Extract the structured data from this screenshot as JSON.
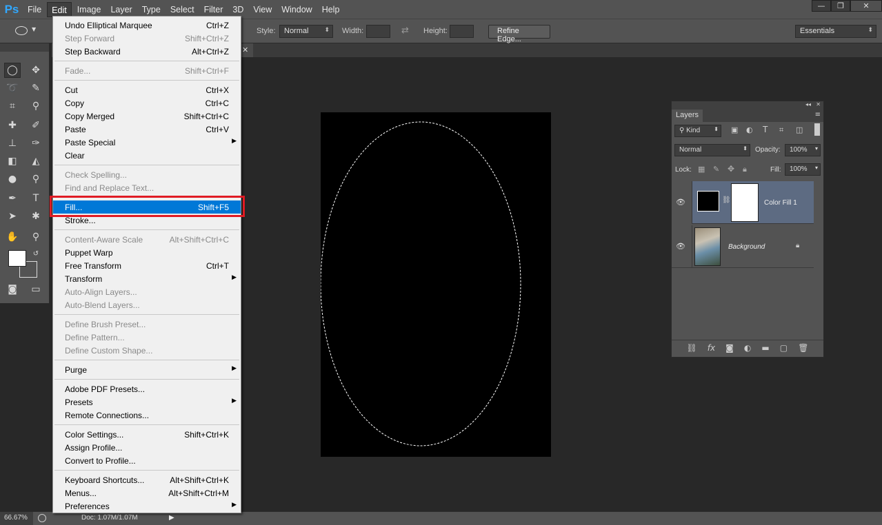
{
  "app": {
    "logo": "Ps"
  },
  "menubar": {
    "items": [
      "File",
      "Edit",
      "Image",
      "Layer",
      "Type",
      "Select",
      "Filter",
      "3D",
      "View",
      "Window",
      "Help"
    ],
    "active": "Edit"
  },
  "window_controls": {
    "minimize": "—",
    "restore": "❐",
    "close": "✕"
  },
  "options_bar": {
    "style_label": "Style:",
    "style_value": "Normal",
    "width_label": "Width:",
    "height_label": "Height:",
    "refine_edge": "Refine Edge...",
    "workspace": "Essentials"
  },
  "status_bar": {
    "zoom": "66.67%",
    "doc": "Doc: 1.07M/1.07M"
  },
  "edit_menu": [
    {
      "label": "Undo Elliptical Marquee",
      "shortcut": "Ctrl+Z",
      "enabled": true
    },
    {
      "label": "Step Forward",
      "shortcut": "Shift+Ctrl+Z",
      "enabled": false
    },
    {
      "label": "Step Backward",
      "shortcut": "Alt+Ctrl+Z",
      "enabled": true
    },
    {
      "sep": true
    },
    {
      "label": "Fade...",
      "shortcut": "Shift+Ctrl+F",
      "enabled": false
    },
    {
      "sep": true
    },
    {
      "label": "Cut",
      "shortcut": "Ctrl+X",
      "enabled": true
    },
    {
      "label": "Copy",
      "shortcut": "Ctrl+C",
      "enabled": true
    },
    {
      "label": "Copy Merged",
      "shortcut": "Shift+Ctrl+C",
      "enabled": true
    },
    {
      "label": "Paste",
      "shortcut": "Ctrl+V",
      "enabled": true
    },
    {
      "label": "Paste Special",
      "shortcut": "",
      "enabled": true,
      "submenu": true
    },
    {
      "label": "Clear",
      "shortcut": "",
      "enabled": true
    },
    {
      "sep": true
    },
    {
      "label": "Check Spelling...",
      "shortcut": "",
      "enabled": false
    },
    {
      "label": "Find and Replace Text...",
      "shortcut": "",
      "enabled": false
    },
    {
      "sep": true
    },
    {
      "label": "Fill...",
      "shortcut": "Shift+F5",
      "enabled": true,
      "highlighted": true
    },
    {
      "label": "Stroke...",
      "shortcut": "",
      "enabled": true
    },
    {
      "sep": true
    },
    {
      "label": "Content-Aware Scale",
      "shortcut": "Alt+Shift+Ctrl+C",
      "enabled": false
    },
    {
      "label": "Puppet Warp",
      "shortcut": "",
      "enabled": true
    },
    {
      "label": "Free Transform",
      "shortcut": "Ctrl+T",
      "enabled": true
    },
    {
      "label": "Transform",
      "shortcut": "",
      "enabled": true,
      "submenu": true
    },
    {
      "label": "Auto-Align Layers...",
      "shortcut": "",
      "enabled": false
    },
    {
      "label": "Auto-Blend Layers...",
      "shortcut": "",
      "enabled": false
    },
    {
      "sep": true
    },
    {
      "label": "Define Brush Preset...",
      "shortcut": "",
      "enabled": false
    },
    {
      "label": "Define Pattern...",
      "shortcut": "",
      "enabled": false
    },
    {
      "label": "Define Custom Shape...",
      "shortcut": "",
      "enabled": false
    },
    {
      "sep": true
    },
    {
      "label": "Purge",
      "shortcut": "",
      "enabled": true,
      "submenu": true
    },
    {
      "sep": true
    },
    {
      "label": "Adobe PDF Presets...",
      "shortcut": "",
      "enabled": true
    },
    {
      "label": "Presets",
      "shortcut": "",
      "enabled": true,
      "submenu": true
    },
    {
      "label": "Remote Connections...",
      "shortcut": "",
      "enabled": true
    },
    {
      "sep": true
    },
    {
      "label": "Color Settings...",
      "shortcut": "Shift+Ctrl+K",
      "enabled": true
    },
    {
      "label": "Assign Profile...",
      "shortcut": "",
      "enabled": true
    },
    {
      "label": "Convert to Profile...",
      "shortcut": "",
      "enabled": true
    },
    {
      "sep": true
    },
    {
      "label": "Keyboard Shortcuts...",
      "shortcut": "Alt+Shift+Ctrl+K",
      "enabled": true
    },
    {
      "label": "Menus...",
      "shortcut": "Alt+Shift+Ctrl+M",
      "enabled": true
    },
    {
      "label": "Preferences",
      "shortcut": "",
      "enabled": true,
      "submenu": true
    }
  ],
  "layers_panel": {
    "tab": "Layers",
    "kind": "Kind",
    "blend_mode": "Normal",
    "opacity_label": "Opacity:",
    "opacity": "100%",
    "lock_label": "Lock:",
    "fill_label": "Fill:",
    "fill": "100%",
    "layers": [
      {
        "name": "Color Fill 1",
        "selected": true
      },
      {
        "name": "Background",
        "selected": false,
        "locked": true
      }
    ]
  }
}
